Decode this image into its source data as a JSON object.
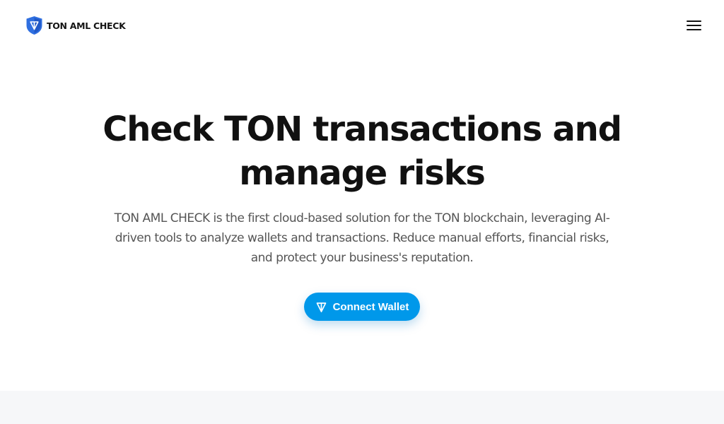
{
  "header": {
    "brand": "TON AML CHECK",
    "logo_icon": "shield-icon",
    "menu_icon": "hamburger-menu-icon"
  },
  "hero": {
    "title_line1": "Check TON transactions and",
    "title_line2": "manage risks",
    "desc_line1": "TON AML CHECK is the first cloud-based solution for the TON blockchain, leveraging AI-",
    "desc_line2": "driven tools to analyze wallets and transactions. Reduce manual efforts, financial risks,",
    "desc_line3": "and protect your business's reputation.",
    "cta_label": "Connect Wallet",
    "cta_icon": "ton-icon"
  },
  "colors": {
    "accent": "#0098ea",
    "logo_blue": "#2f6fe0",
    "title": "#111111",
    "body_text": "#555555",
    "section_bg": "#f6f7f9"
  }
}
